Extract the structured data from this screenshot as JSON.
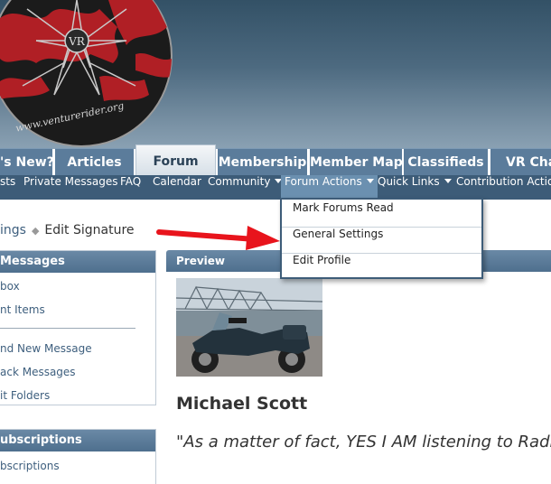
{
  "logo": {
    "text": "VR",
    "url_text": "www.venturerider.org"
  },
  "tabs": [
    "'s New?",
    "Articles",
    "Forum",
    "Membership",
    "Member Map",
    "Classifieds",
    "VR Chat"
  ],
  "subnav": [
    "sts",
    "Private Messages",
    "FAQ",
    "Calendar",
    "Community",
    "Forum Actions",
    "Quick Links",
    "Contribution Actions"
  ],
  "breadcrumb": {
    "parent": "ings",
    "current": "Edit Signature"
  },
  "sidebar": {
    "messages_title": "Messages",
    "messages_links": [
      "box",
      "nt Items",
      "nd New Message",
      "ack Messages",
      "it Folders"
    ],
    "subscriptions_title": "ubscriptions",
    "subscriptions_links": [
      "bscriptions"
    ]
  },
  "dropdown": [
    "Mark Forums Read",
    "General Settings",
    "Edit Profile"
  ],
  "preview": {
    "header": "Preview",
    "name": "Michael Scott",
    "quote": "\"As a matter of fact, YES I AM listening to Radio"
  },
  "colors": {
    "nav_tab": "#5b7c9b",
    "subnav": "#3d5c78",
    "panel_head": "#4e6f8e",
    "arrow": "#e8141c",
    "link": "#3e5f7e"
  }
}
